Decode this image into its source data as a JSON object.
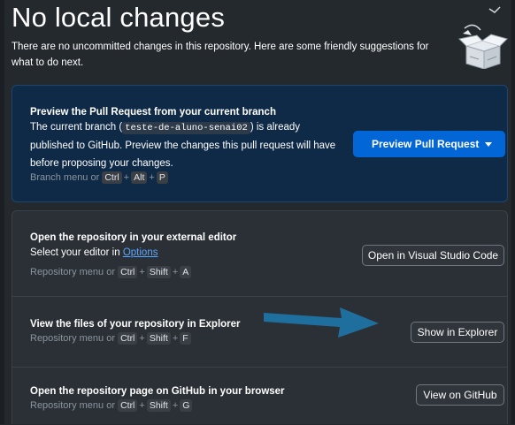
{
  "header": {
    "title": "No local changes",
    "subtitle": "There are no uncommitted changes in this repository. Here are some friendly suggestions for what to do next."
  },
  "pull_request": {
    "title": "Preview the Pull Request from your current branch",
    "desc_prefix": "The current branch (",
    "branch": "teste-de-aluno-senai02",
    "desc_suffix": ") is already published to GitHub. Preview the changes this pull request will have before proposing your changes.",
    "hint_prefix": "Branch menu or",
    "keys": [
      "Ctrl",
      "Alt",
      "P"
    ],
    "button_label": "Preview Pull Request"
  },
  "editor": {
    "title": "Open the repository in your external editor",
    "desc_prefix": "Select your editor in",
    "link": "Options",
    "hint_prefix": "Repository menu or",
    "keys": [
      "Ctrl",
      "Shift",
      "A"
    ],
    "button_label": "Open in Visual Studio Code"
  },
  "explorer": {
    "title": "View the files of your repository in Explorer",
    "hint_prefix": "Repository menu or",
    "keys": [
      "Ctrl",
      "Shift",
      "F"
    ],
    "button_label": "Show in Explorer"
  },
  "github": {
    "title": "Open the repository page on GitHub in your browser",
    "hint_prefix": "Repository menu or",
    "keys": [
      "Ctrl",
      "Shift",
      "G"
    ],
    "button_label": "View on GitHub"
  },
  "colors": {
    "background": "#24292e",
    "accent": "#0366d6",
    "annotation_arrow": "#1f6f9e",
    "link": "#58a6ff"
  },
  "icons": [
    "empty-box-illustration",
    "chevron-down-icon",
    "arrow-annotation"
  ]
}
